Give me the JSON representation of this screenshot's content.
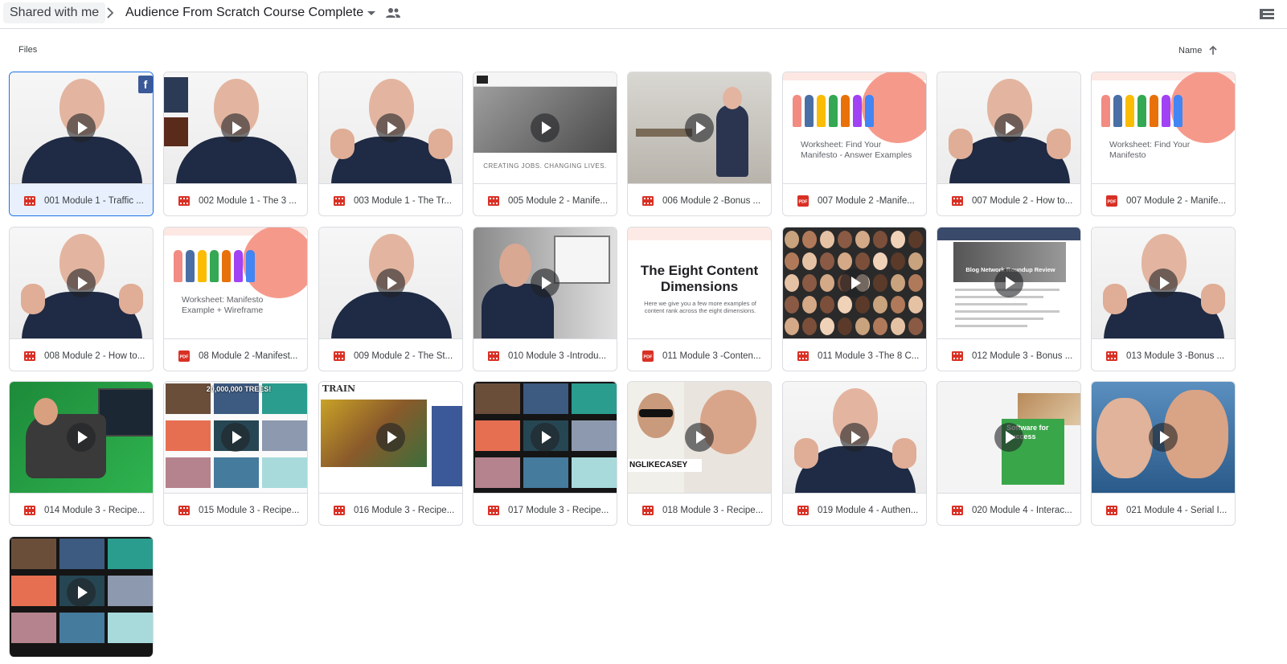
{
  "header": {
    "breadcrumb_root": "Shared with me",
    "folder_name": "Audience From Scratch Course Complete"
  },
  "list_header": {
    "section_label": "Files",
    "sort_label": "Name"
  },
  "colors": {
    "selected_border": "#1a73e8",
    "video_icon": "#d93025",
    "pdf_icon": "#d93025"
  },
  "files": [
    {
      "name": "001 Module 1 - Traffic ...",
      "type": "video",
      "thumb": "person",
      "selected": true
    },
    {
      "name": "002 Module 1 - The 3 ...",
      "type": "video",
      "thumb": "person-books"
    },
    {
      "name": "003 Module 1 - The Tr...",
      "type": "video",
      "thumb": "person-hand"
    },
    {
      "name": "005 Module 2 - Manife...",
      "type": "video",
      "thumb": "website",
      "thumb_text": "CREATING JOBS. CHANGING LIVES."
    },
    {
      "name": "006 Module 2 -Bonus ...",
      "type": "video",
      "thumb": "room"
    },
    {
      "name": "007 Module 2 -Manife...",
      "type": "pdf",
      "thumb": "worksheet",
      "thumb_text": "Worksheet: Find Your Manifesto - Answer Examples"
    },
    {
      "name": "007 Module 2 - How to...",
      "type": "video",
      "thumb": "person-hand"
    },
    {
      "name": "007 Module 2 - Manife...",
      "type": "pdf",
      "thumb": "worksheet",
      "thumb_text": "Worksheet: Find Your Manifesto"
    },
    {
      "name": "008 Module 2 - How to...",
      "type": "video",
      "thumb": "person-hand"
    },
    {
      "name": "08 Module 2 -Manifest...",
      "type": "pdf",
      "thumb": "worksheet",
      "thumb_text": "Worksheet: Manifesto Example + Wireframe"
    },
    {
      "name": "009 Module 2 - The St...",
      "type": "video",
      "thumb": "person"
    },
    {
      "name": "010 Module 3 -Introdu...",
      "type": "video",
      "thumb": "room-window"
    },
    {
      "name": "011 Module 3 -Conten...",
      "type": "pdf",
      "thumb": "slide",
      "thumb_text": "The Eight Content Dimensions",
      "thumb_subtext": "Here we give you a few more examples of content rank across the eight dimensions."
    },
    {
      "name": "011 Module 3 -The 8 C...",
      "type": "video",
      "thumb": "crowd"
    },
    {
      "name": "012 Module 3 - Bonus ...",
      "type": "video",
      "thumb": "blog",
      "thumb_text": "Blog Network Roundup Review"
    },
    {
      "name": "013 Module 3 -Bonus ...",
      "type": "video",
      "thumb": "person-hand"
    },
    {
      "name": "014 Module 3 - Recipe...",
      "type": "video",
      "thumb": "greenscreen"
    },
    {
      "name": "015 Module 3 - Recipe...",
      "type": "video",
      "thumb": "youtube",
      "thumb_text": "20,000,000 TREES!"
    },
    {
      "name": "016 Module 3 - Recipe...",
      "type": "video",
      "thumb": "train",
      "thumb_text": "TRAIN"
    },
    {
      "name": "017 Module 3 - Recipe...",
      "type": "video",
      "thumb": "youtube-dark"
    },
    {
      "name": "018 Module 3 - Recipe...",
      "type": "video",
      "thumb": "casey",
      "thumb_text": "NGLIKECASEY"
    },
    {
      "name": "019 Module 4 - Authen...",
      "type": "video",
      "thumb": "person-hand"
    },
    {
      "name": "020 Module 4 - Interac...",
      "type": "video",
      "thumb": "software",
      "thumb_text": "Software for Success"
    },
    {
      "name": "021 Module 4 - Serial I...",
      "type": "video",
      "thumb": "faces"
    },
    {
      "name": "",
      "type": "video",
      "thumb": "youtube-dark"
    }
  ]
}
